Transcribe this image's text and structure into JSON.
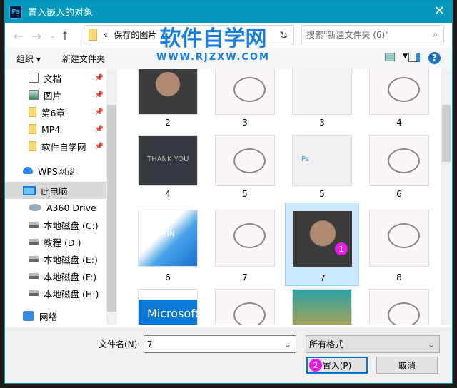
{
  "title": "置入嵌入的对象",
  "app_icon": "Ps",
  "address": {
    "prefix": "«",
    "path": "保存的图片"
  },
  "search_placeholder": "搜索\"新建文件夹 (6)\"",
  "toolbar": {
    "organize": "组织 ▾",
    "new_folder": "新建文件夹"
  },
  "nav": [
    {
      "label": "文档",
      "icon": "document-icon",
      "pinned": true
    },
    {
      "label": "图片",
      "icon": "picture-icon",
      "pinned": true
    },
    {
      "label": "第6章",
      "icon": "folder-icon",
      "pinned": true
    },
    {
      "label": "MP4",
      "icon": "folder-icon",
      "pinned": true
    },
    {
      "label": "软件自学网",
      "icon": "folder-icon",
      "pinned": true
    },
    {
      "label": "WPS网盘",
      "icon": "cloud-icon"
    },
    {
      "label": "此电脑",
      "icon": "computer-icon",
      "selected": true
    },
    {
      "label": "A360 Drive",
      "icon": "a360-icon"
    },
    {
      "label": "本地磁盘 (C:)",
      "icon": "drive-icon"
    },
    {
      "label": "教程 (D:)",
      "icon": "drive-icon"
    },
    {
      "label": "本地磁盘 (E:)",
      "icon": "drive-icon"
    },
    {
      "label": "本地磁盘 (F:)",
      "icon": "drive-icon"
    },
    {
      "label": "本地磁盘 (H:)",
      "icon": "drive-icon"
    },
    {
      "label": "网络",
      "icon": "network-icon"
    }
  ],
  "files": [
    {
      "name": "2",
      "kind": "photo"
    },
    {
      "name": "3",
      "kind": "drawing"
    },
    {
      "name": "3",
      "kind": "certificate"
    },
    {
      "name": "4",
      "kind": "drawing"
    },
    {
      "name": "4",
      "kind": "thankyou"
    },
    {
      "name": "5",
      "kind": "drawing"
    },
    {
      "name": "5",
      "kind": "ps"
    },
    {
      "name": "6",
      "kind": "drawing"
    },
    {
      "name": "6",
      "kind": "design"
    },
    {
      "name": "7",
      "kind": "drawing"
    },
    {
      "name": "7",
      "kind": "photo",
      "selected": true,
      "badge": "1"
    },
    {
      "name": "8",
      "kind": "drawing"
    },
    {
      "name": "",
      "kind": "microsoft"
    },
    {
      "name": "",
      "kind": "drawing"
    },
    {
      "name": "",
      "kind": "poster"
    },
    {
      "name": "",
      "kind": "drawing"
    }
  ],
  "thumb_text": {
    "thankyou": "THANK YOU",
    "design": "DESIGN",
    "microsoft": "Microsoft",
    "ps": "Ps"
  },
  "filename_label": "文件名(N):",
  "filename_value": "7",
  "filetype": "所有格式",
  "place_button": "置入(P)",
  "place_badge": "2",
  "cancel_button": "取消",
  "watermark": {
    "title": "软件自学网",
    "url": "WWW.RJZXW.COM"
  },
  "accent": "#0499bd"
}
